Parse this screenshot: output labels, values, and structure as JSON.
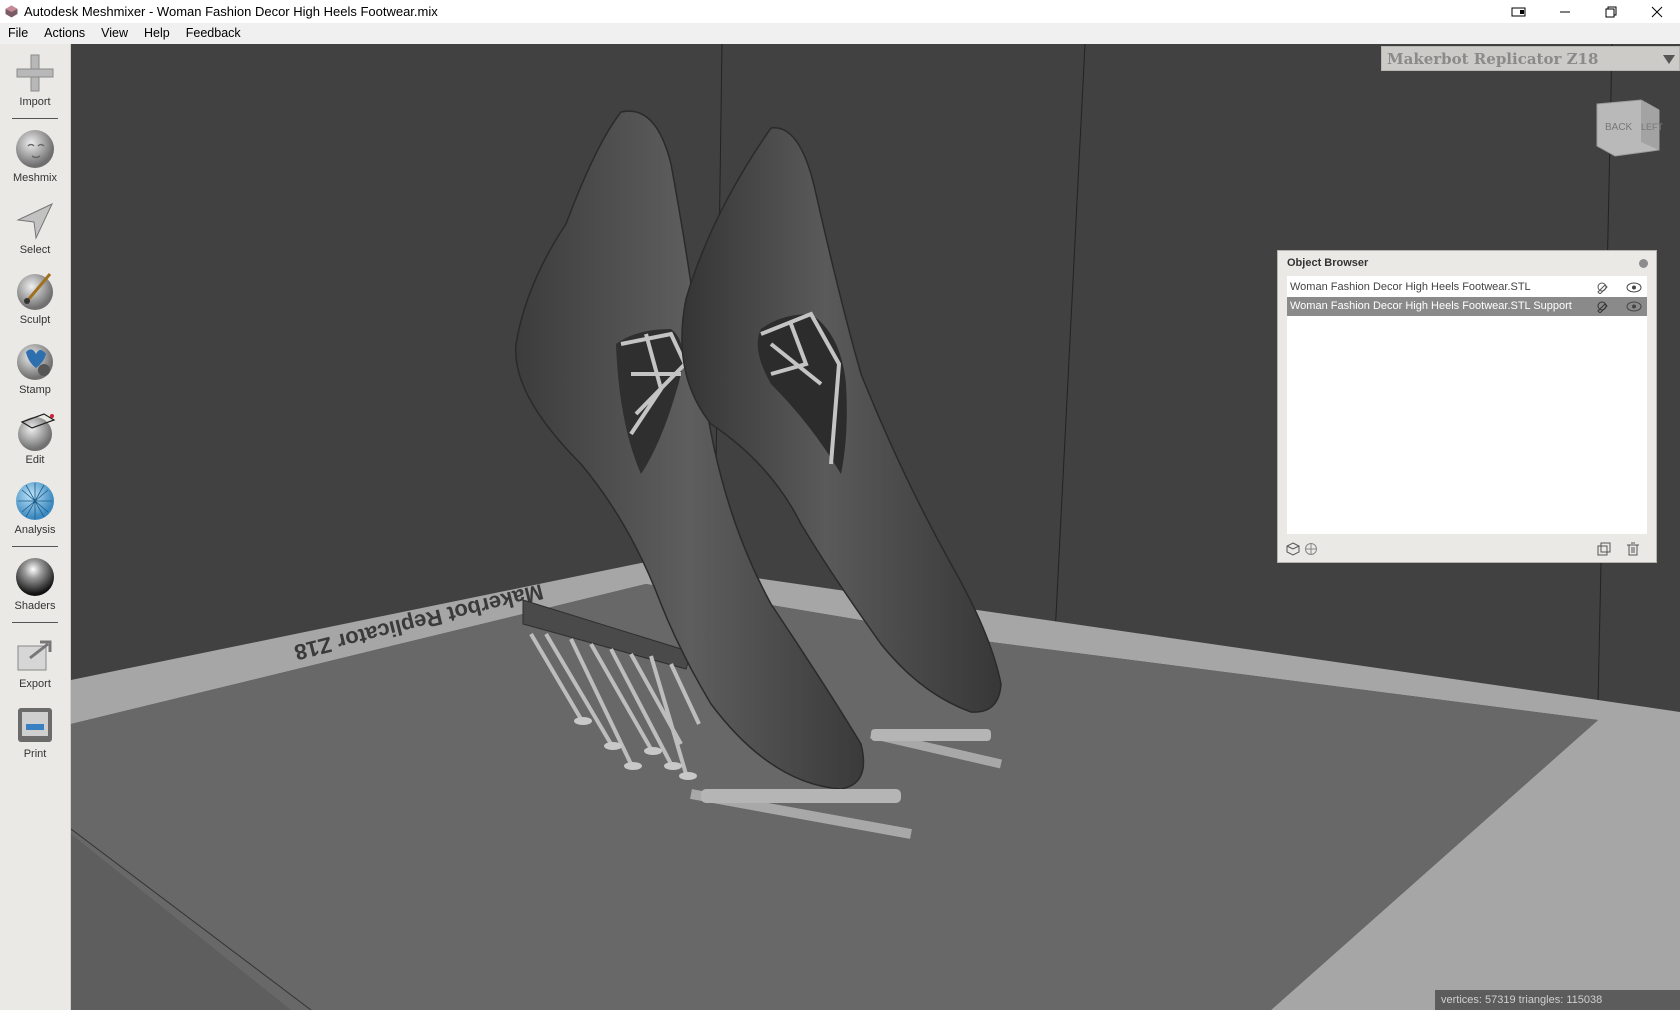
{
  "window": {
    "title": "Autodesk Meshmixer - Woman Fashion Decor High Heels Footwear.mix"
  },
  "menu": [
    "File",
    "Actions",
    "View",
    "Help",
    "Feedback"
  ],
  "toolbar": {
    "import": "Import",
    "meshmix": "Meshmix",
    "select": "Select",
    "sculpt": "Sculpt",
    "stamp": "Stamp",
    "edit": "Edit",
    "analysis": "Analysis",
    "shaders": "Shaders",
    "export": "Export",
    "print": "Print"
  },
  "viewport": {
    "printer": "Makerbot Replicator Z18",
    "bed_label": "Makerbot Replicator Z18",
    "viewcube": {
      "face1": "BACK",
      "face2": "LEFT"
    }
  },
  "object_browser": {
    "title": "Object Browser",
    "items": [
      {
        "name": "Woman Fashion Decor High Heels Footwear.STL",
        "selected": false
      },
      {
        "name": "Woman Fashion Decor High Heels Footwear.STL Support",
        "selected": true
      }
    ]
  },
  "status": {
    "text": "vertices: 57319 triangles: 115038"
  },
  "colors": {
    "viewport_bg": "#414141",
    "bed": "#6a6a6a",
    "bed_edge": "#a9a9a9",
    "toolbar_bg": "#ebe9e6",
    "selected_row": "#8a8a8a"
  }
}
